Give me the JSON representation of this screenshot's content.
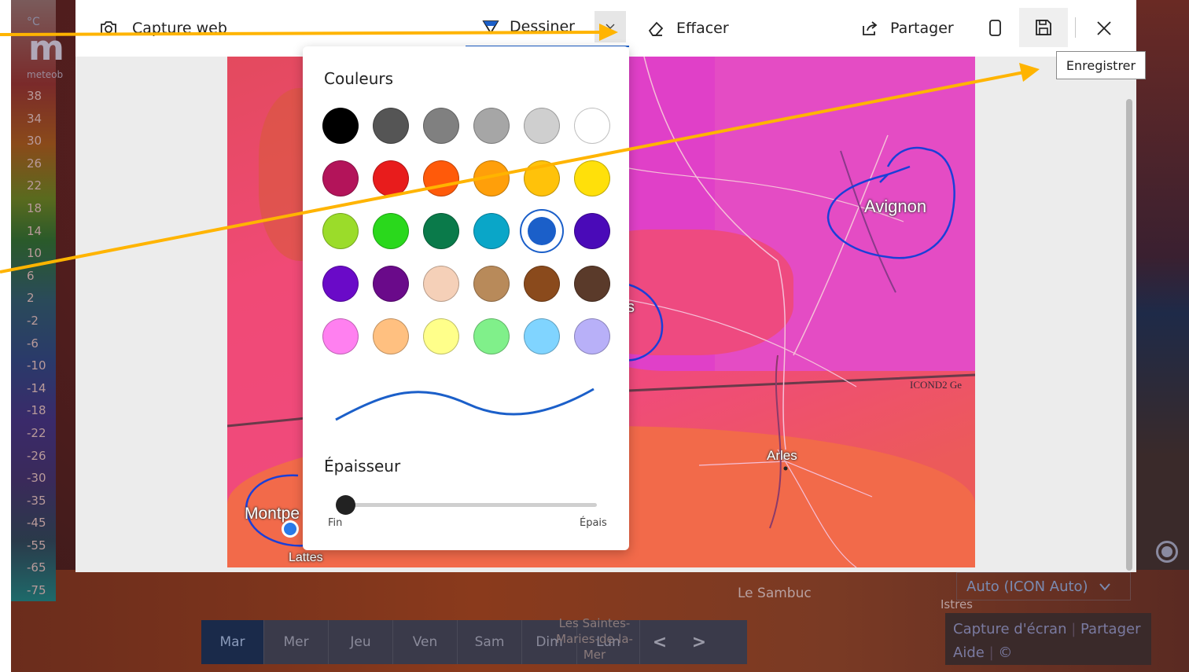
{
  "background": {
    "legend": {
      "unit": "°C",
      "logo": "m",
      "brand": "meteob",
      "ticks": [
        "38",
        "34",
        "30",
        "26",
        "22",
        "18",
        "14",
        "10",
        "6",
        "2",
        "-2",
        "-6",
        "-10",
        "-14",
        "-18",
        "-22",
        "-26",
        "-30",
        "-35",
        "-45",
        "-55",
        "-65",
        "-75"
      ]
    },
    "places": {
      "le_sambuc": "Le Sambuc",
      "istres": "Istres",
      "saintes": "Les Saintes-Maries-de-la-Mer"
    },
    "days": [
      "Mar",
      "Mer",
      "Jeu",
      "Ven",
      "Sam",
      "Dim",
      "Lun"
    ],
    "nav_prev": "<",
    "nav_next": ">",
    "model_select": "Auto (ICON Auto)",
    "links": {
      "screenshot": "Capture d'écran",
      "share": "Partager",
      "help": "Aide",
      "copyright": "©"
    }
  },
  "capture": {
    "title": "Capture web",
    "draw_label": "Dessiner",
    "erase_label": "Effacer",
    "share_label": "Partager",
    "save_tooltip": "Enregistrer",
    "map_labels": {
      "avignon": "Avignon",
      "arles": "Arles",
      "icond2": "ICOND2 Ge",
      "montpellier": "Montpe",
      "lattes": "Lattes",
      "partial_s": "s"
    }
  },
  "draw_popup": {
    "colors_title": "Couleurs",
    "colors": [
      "#000000",
      "#555555",
      "#808080",
      "#a6a6a6",
      "#cfcfcf",
      "#ffffff",
      "#b3145a",
      "#e81c1c",
      "#ff5a0a",
      "#ff9f0a",
      "#ffc20a",
      "#ffe00a",
      "#9bdc2a",
      "#2ad81c",
      "#0a7a4a",
      "#0aa6c8",
      "#1b5fc9",
      "#4a0ab8",
      "#6a0ac8",
      "#6a0a8a",
      "#f5d0b8",
      "#b88a5a",
      "#8a4a1c",
      "#5a3a2a",
      "#ff80f0",
      "#ffc080",
      "#ffff8a",
      "#80f08a",
      "#80d4ff",
      "#b8b0f8"
    ],
    "selected_color_index": 16,
    "stroke_color": "#1b5fc9",
    "thickness_title": "Épaisseur",
    "thickness_min_label": "Fin",
    "thickness_max_label": "Épais",
    "thickness_value": 0.0
  },
  "annotation_color": "#ffb400"
}
